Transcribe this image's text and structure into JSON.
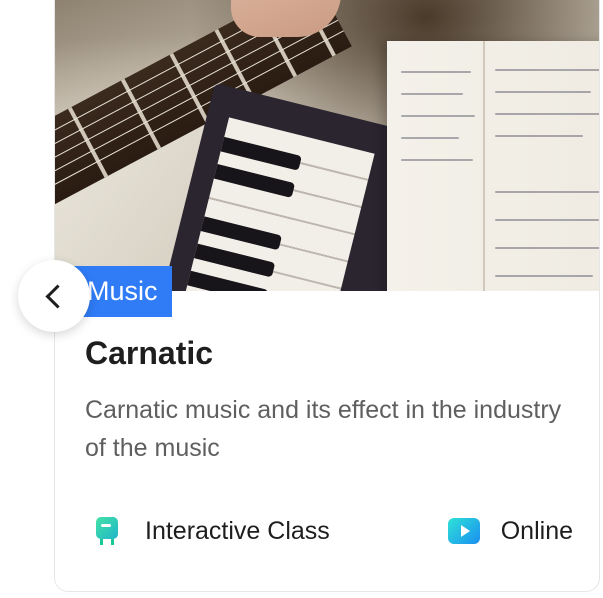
{
  "course_card": {
    "category": "Music",
    "title": "Carnatic",
    "description": "Carnatic music and its effect in the industry of the music",
    "class_type": {
      "label": "Interactive Class",
      "icon": "interactive-class-icon"
    },
    "mode": {
      "label": "Online",
      "icon": "online-play-icon"
    },
    "image_alt": "guitar, piano and music notebook"
  },
  "carousel": {
    "prev_icon": "chevron-left-icon"
  },
  "colors": {
    "accent": "#2f7cf6",
    "title": "#1e1e1e",
    "description": "#5f5f5f",
    "class_icon": "#1fc99b",
    "online_icon": "#1a8ff1"
  }
}
